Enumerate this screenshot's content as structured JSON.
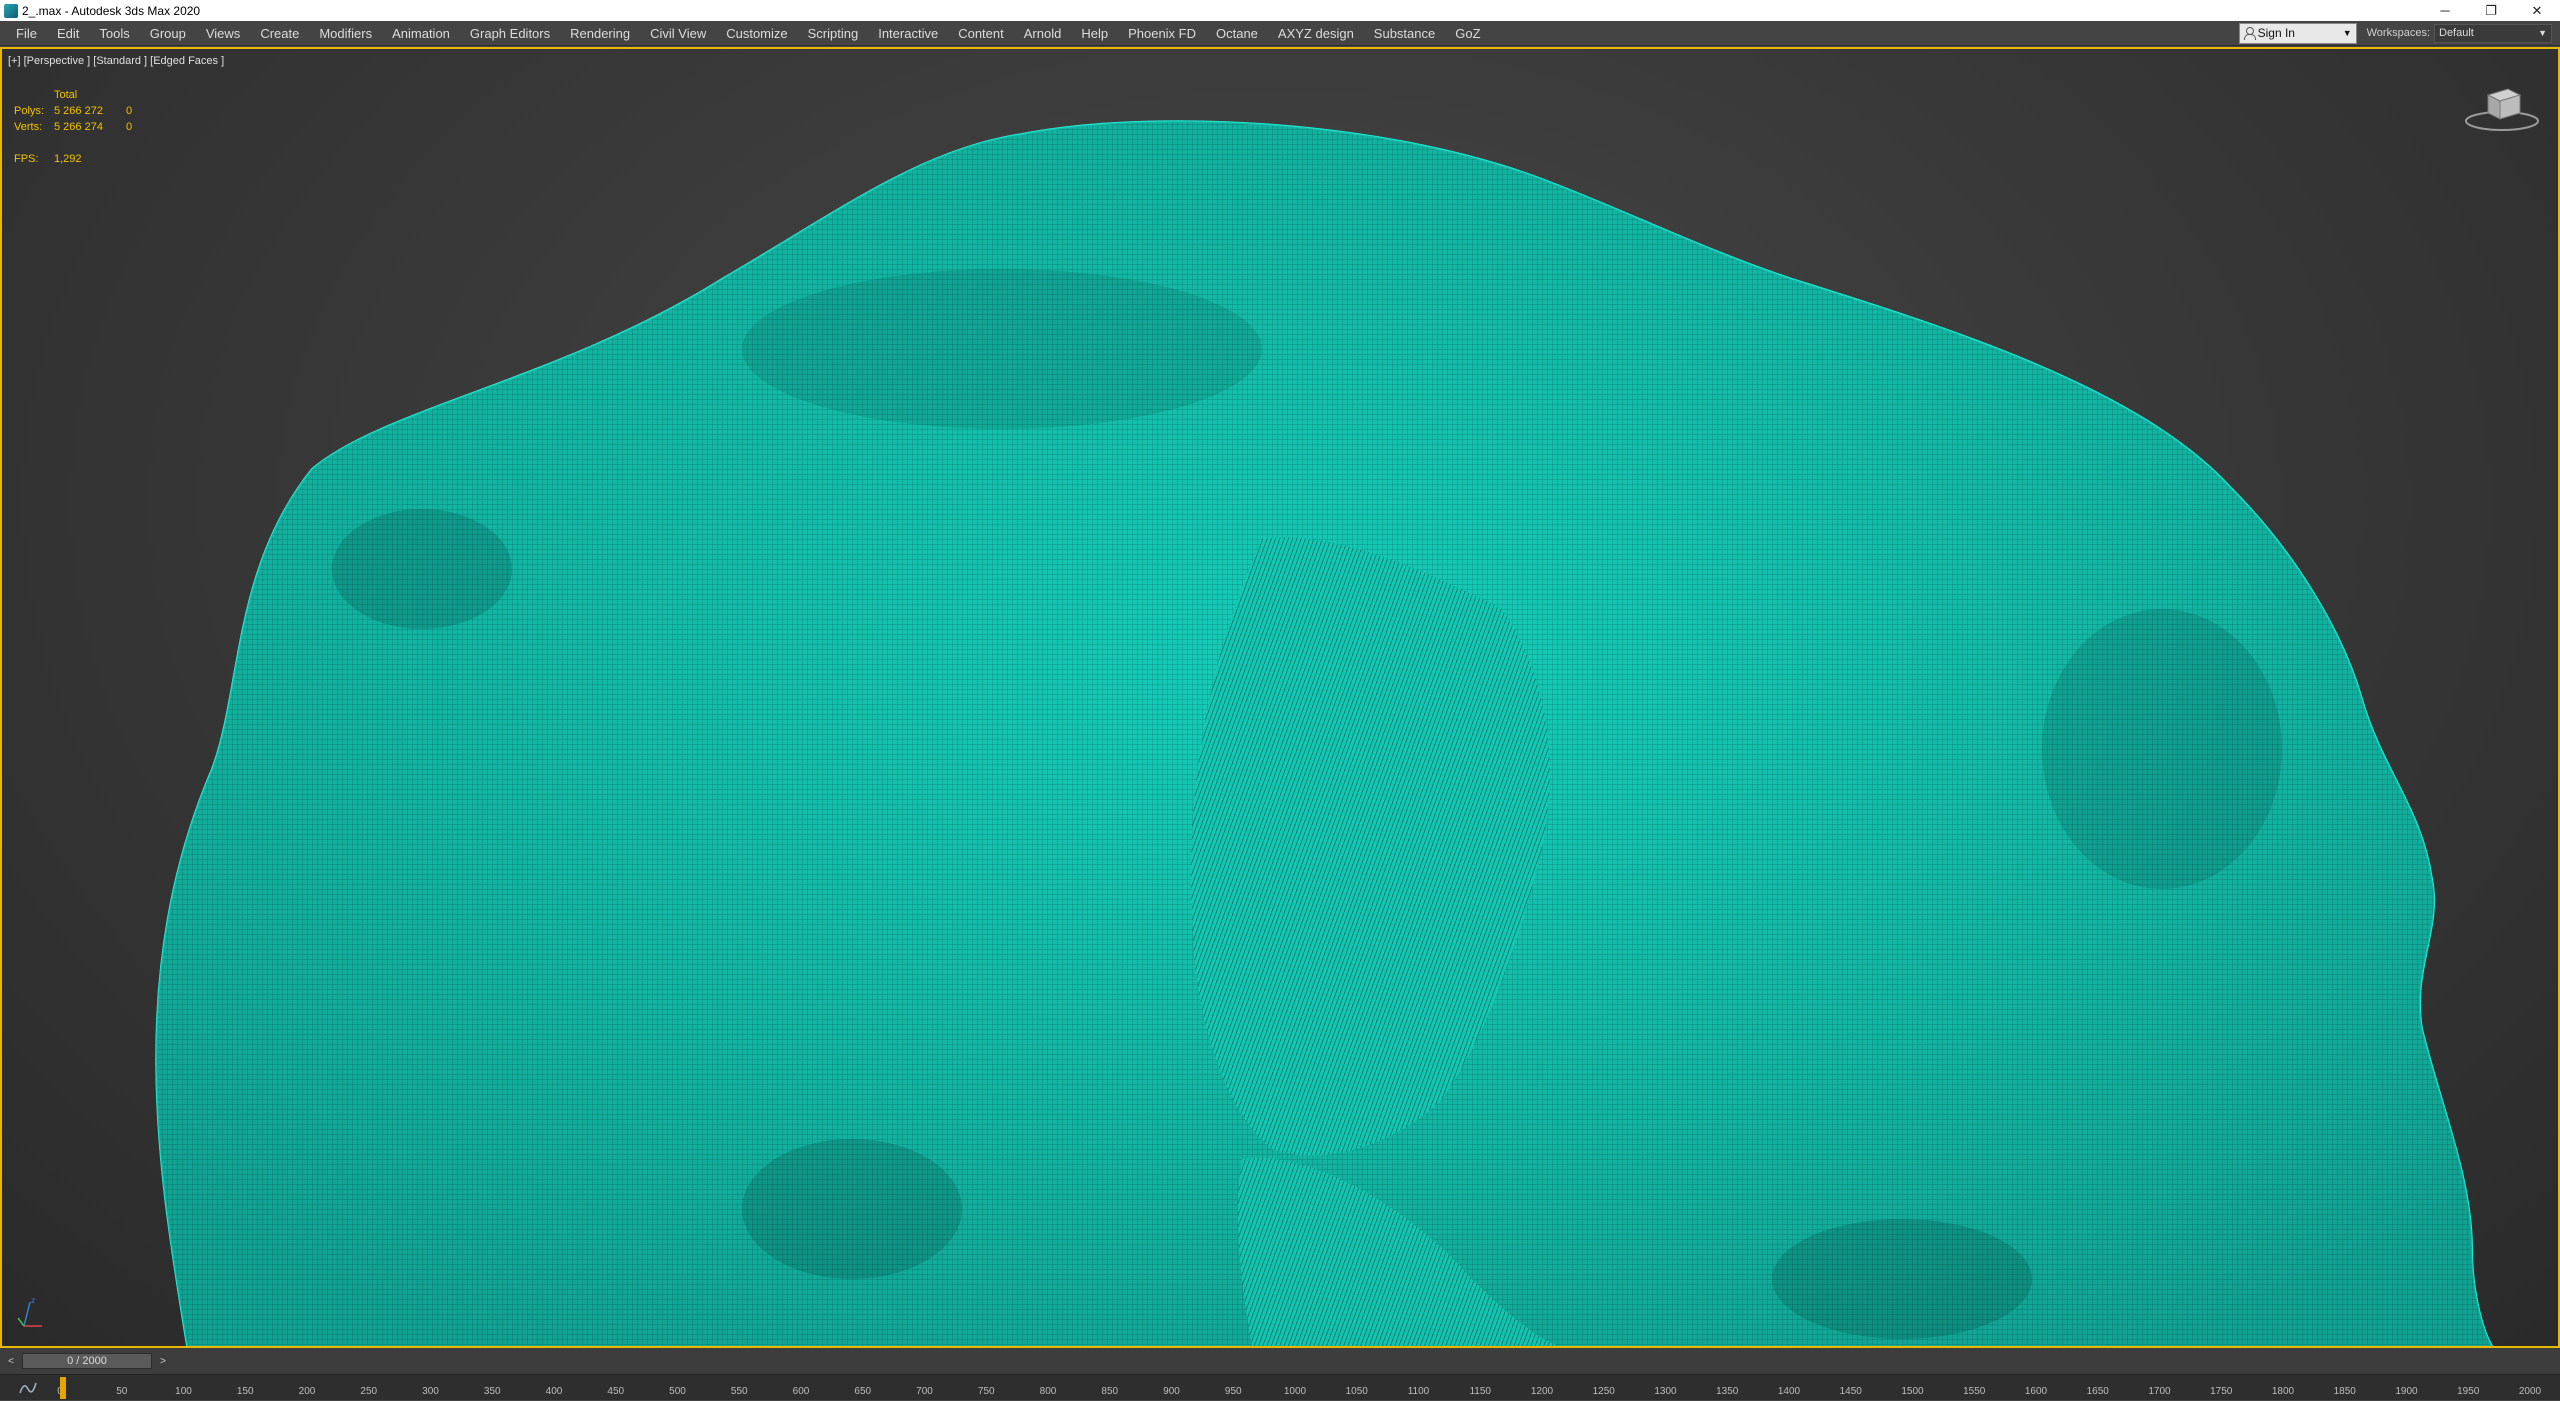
{
  "window": {
    "title": "2_.max - Autodesk 3ds Max 2020",
    "minimize": "─",
    "restore": "❐",
    "close": "✕"
  },
  "menu": {
    "items": [
      "File",
      "Edit",
      "Tools",
      "Group",
      "Views",
      "Create",
      "Modifiers",
      "Animation",
      "Graph Editors",
      "Rendering",
      "Civil View",
      "Customize",
      "Scripting",
      "Interactive",
      "Content",
      "Arnold",
      "Help",
      "Phoenix FD",
      "Octane",
      "AXYZ design",
      "Substance",
      "GoZ"
    ],
    "sign_in": "Sign In",
    "workspaces_label": "Workspaces:",
    "workspace_value": "Default"
  },
  "viewport": {
    "label": "[+] [Perspective ] [Standard ] [Edged Faces ]",
    "stats": {
      "total_label": "Total",
      "polys_label": "Polys:",
      "polys_value": "5 266 272",
      "polys_sel": "0",
      "verts_label": "Verts:",
      "verts_value": "5 266 274",
      "verts_sel": "0",
      "fps_label": "FPS:",
      "fps_value": "1,292"
    },
    "mesh_color": "#19e0c8"
  },
  "timeline": {
    "frame_display": "0 / 2000",
    "prev": "<",
    "next": ">",
    "ticks": [
      "0",
      "50",
      "100",
      "150",
      "200",
      "250",
      "300",
      "350",
      "400",
      "450",
      "500",
      "550",
      "600",
      "650",
      "700",
      "750",
      "800",
      "850",
      "900",
      "950",
      "1000",
      "1050",
      "1100",
      "1150",
      "1200",
      "1250",
      "1300",
      "1350",
      "1400",
      "1450",
      "1500",
      "1550",
      "1600",
      "1650",
      "1700",
      "1750",
      "1800",
      "1850",
      "1900",
      "1950",
      "2000"
    ]
  }
}
